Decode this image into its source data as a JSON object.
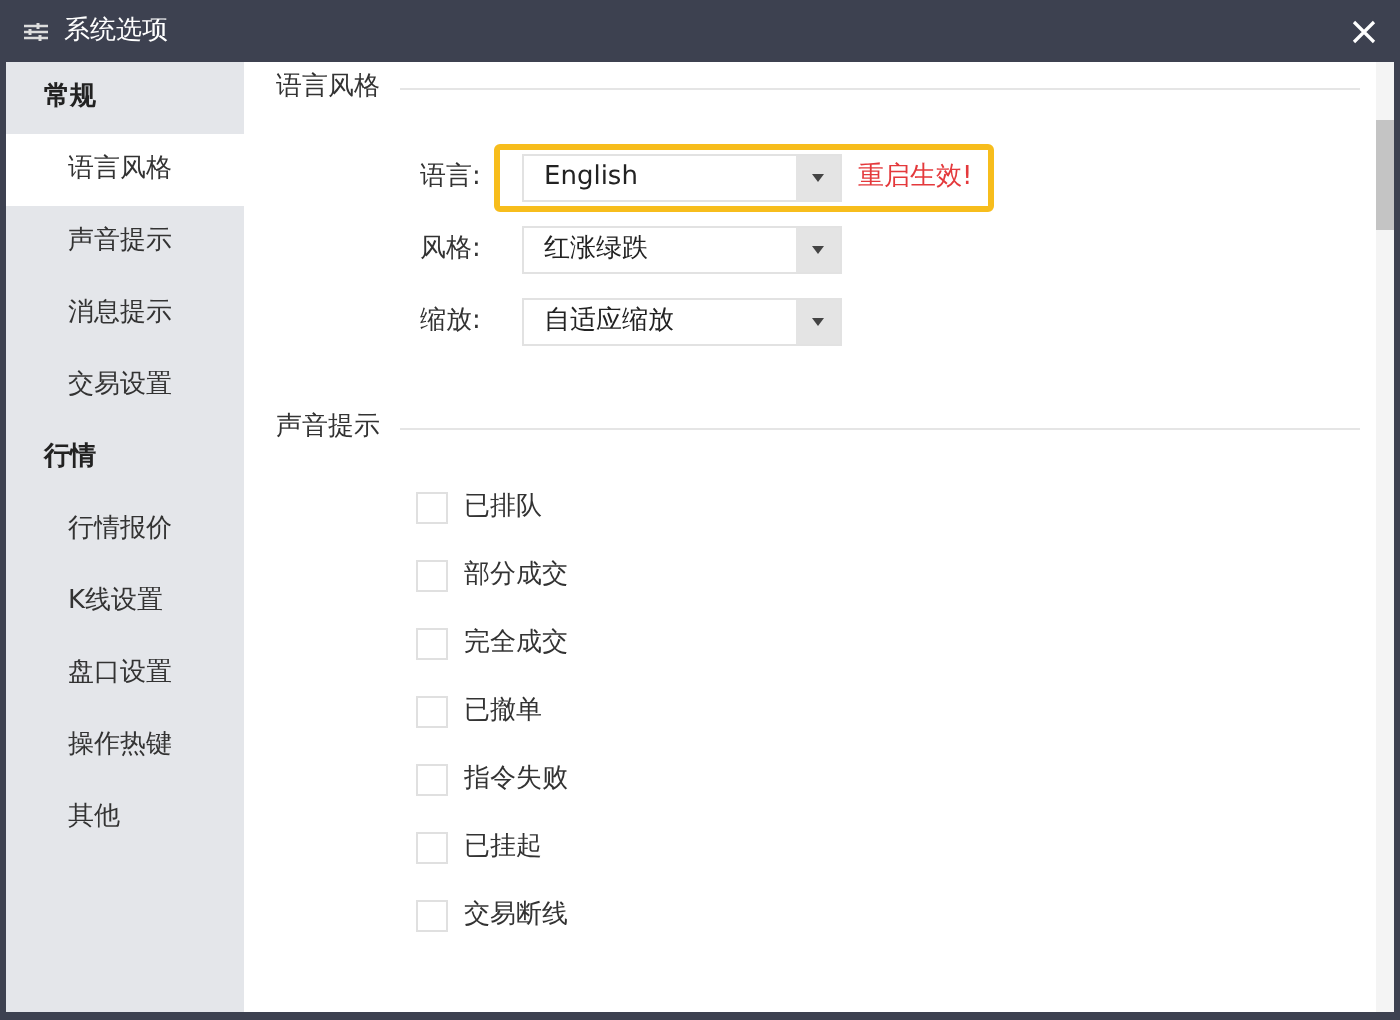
{
  "window": {
    "title": "系统选项"
  },
  "sidebar": {
    "groups": [
      {
        "label": "常规",
        "items": [
          {
            "label": "语言风格",
            "selected": true
          },
          {
            "label": "声音提示",
            "selected": false
          },
          {
            "label": "消息提示",
            "selected": false
          },
          {
            "label": "交易设置",
            "selected": false
          }
        ]
      },
      {
        "label": "行情",
        "items": [
          {
            "label": "行情报价",
            "selected": false
          },
          {
            "label": "K线设置",
            "selected": false
          },
          {
            "label": "盘口设置",
            "selected": false
          },
          {
            "label": "操作热键",
            "selected": false
          },
          {
            "label": "其他",
            "selected": false
          }
        ]
      }
    ]
  },
  "sections": [
    {
      "title": "语言风格",
      "kind": "selects",
      "fields": [
        {
          "label": "语言:",
          "value": "English",
          "highlighted": true,
          "note": "重启生效!"
        },
        {
          "label": "风格:",
          "value": "红涨绿跌",
          "highlighted": false
        },
        {
          "label": "缩放:",
          "value": "自适应缩放",
          "highlighted": false
        }
      ]
    },
    {
      "title": "声音提示",
      "kind": "checks",
      "options": [
        {
          "label": "已排队",
          "checked": false
        },
        {
          "label": "部分成交",
          "checked": false
        },
        {
          "label": "完全成交",
          "checked": false
        },
        {
          "label": "已撤单",
          "checked": false
        },
        {
          "label": "指令失败",
          "checked": false
        },
        {
          "label": "已挂起",
          "checked": false
        },
        {
          "label": "交易断线",
          "checked": false
        }
      ]
    }
  ]
}
